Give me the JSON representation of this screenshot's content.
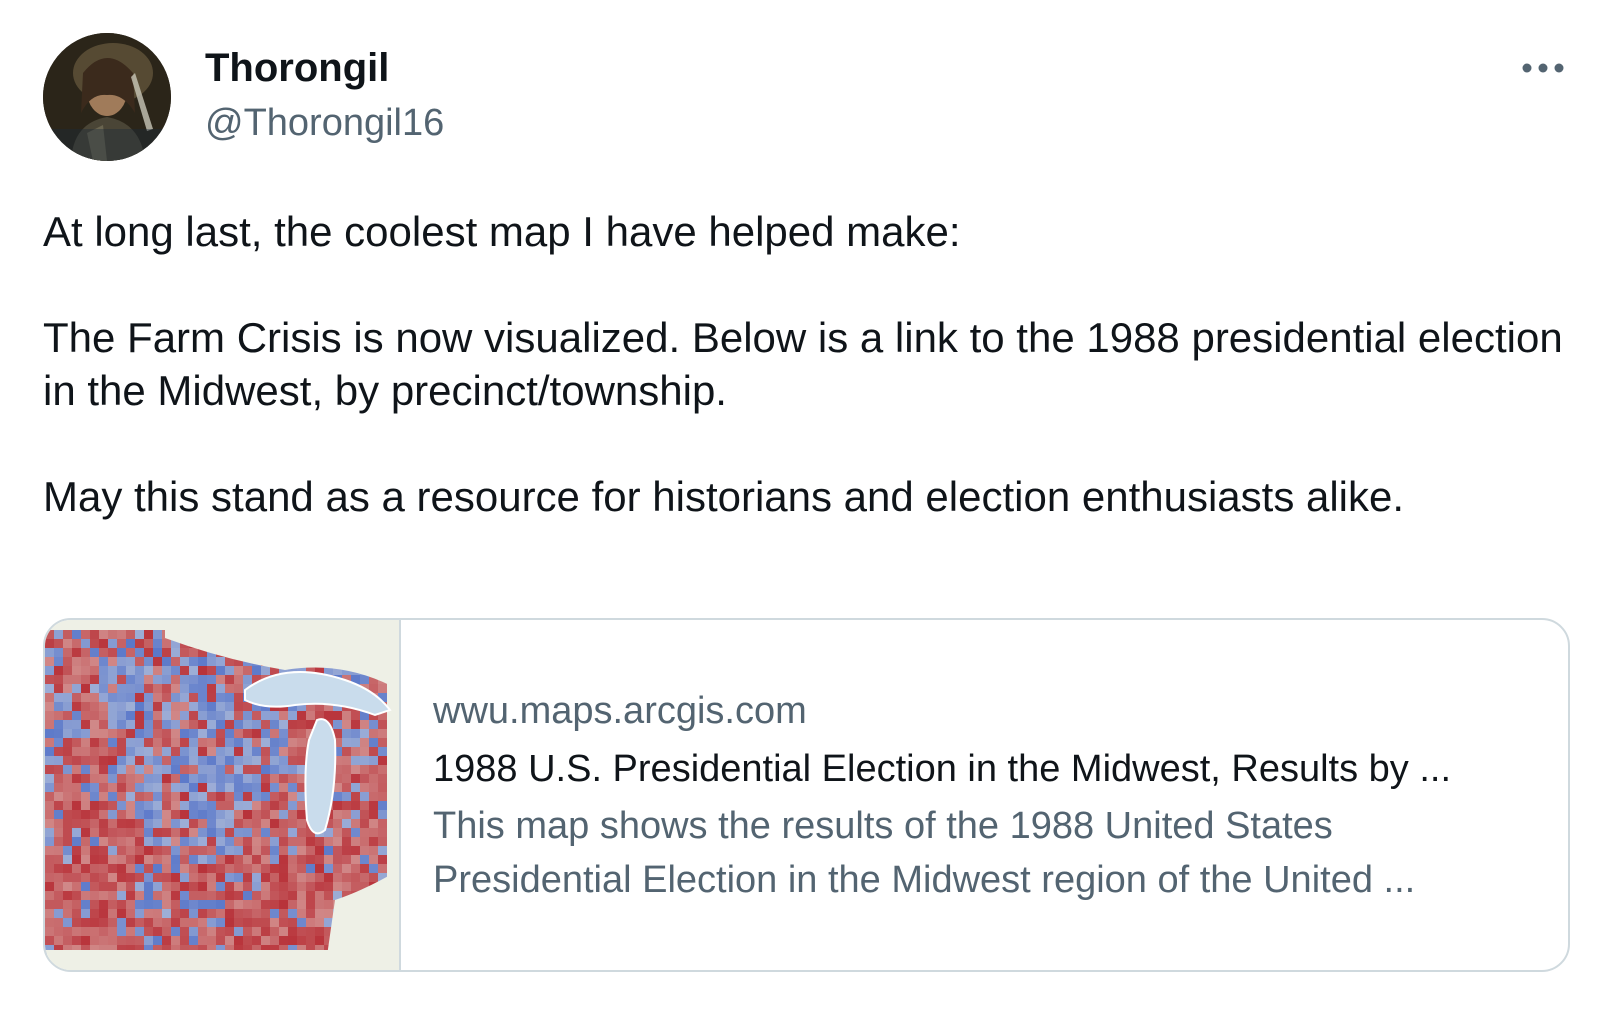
{
  "author": {
    "display_name": "Thorongil",
    "handle": "@Thorongil16"
  },
  "menu": {
    "icon": "more-horizontal-icon",
    "label": "•••"
  },
  "tweet": {
    "paragraphs": [
      "At long last, the coolest map I have helped make:",
      "The Farm Crisis is now visualized. Below is a link to the 1988 presidential election in the Midwest, by precinct/township.",
      "May this stand as a resource for historians and election enthusiasts alike."
    ]
  },
  "link_card": {
    "domain": "wwu.maps.arcgis.com",
    "title": "1988 U.S. Presidential Election in the Midwest, Results by ...",
    "description_line1": "This map shows the results of the 1988 United States",
    "description_line2": "Presidential Election in the Midwest region of the United ...",
    "thumbnail_icon": "election-map-thumbnail"
  },
  "colors": {
    "text_primary": "#0f1419",
    "text_secondary": "#536471",
    "border": "#cfd9de",
    "map_red": "#b8333a",
    "map_blue": "#5b78c9",
    "lake": "#c9dcec"
  }
}
